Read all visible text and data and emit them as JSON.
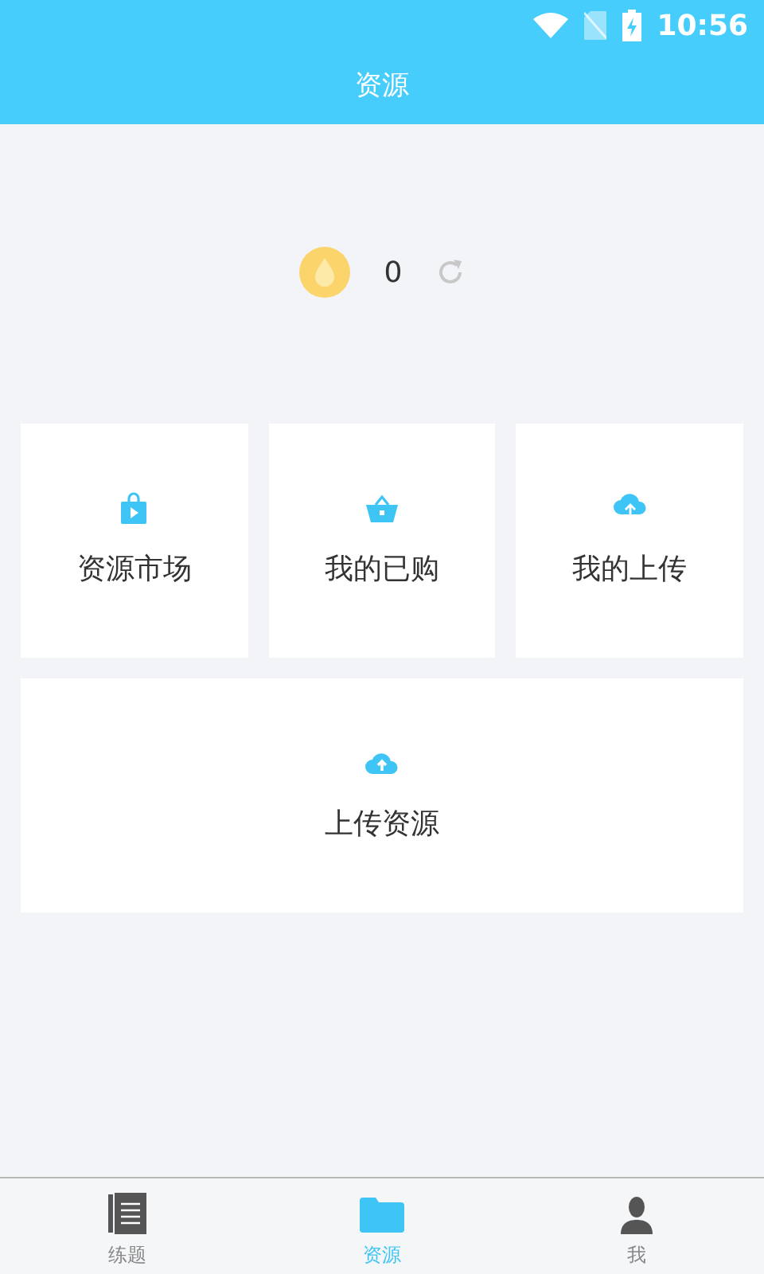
{
  "status_bar": {
    "time": "10:56"
  },
  "header": {
    "title": "资源"
  },
  "balance": {
    "amount": "0"
  },
  "cards": [
    {
      "kind": "market",
      "label": "资源市场"
    },
    {
      "kind": "purchased",
      "label": "我的已购"
    },
    {
      "kind": "uploads",
      "label": "我的上传"
    }
  ],
  "wide_card": {
    "kind": "upload",
    "label": "上传资源"
  },
  "tabs": [
    {
      "kind": "exercises",
      "label": "练题",
      "selected": false
    },
    {
      "kind": "resources",
      "label": "资源",
      "selected": true
    },
    {
      "kind": "me",
      "label": "我",
      "selected": false
    }
  ]
}
